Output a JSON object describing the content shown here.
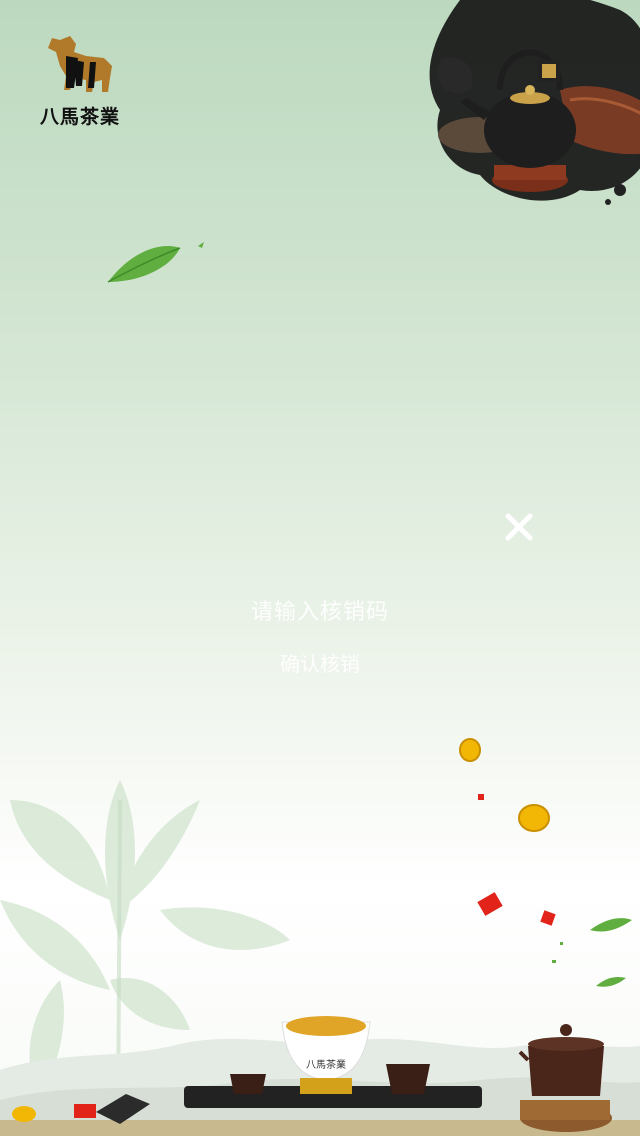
{
  "brand": {
    "name": "八馬茶業",
    "cup_label": "八馬茶業"
  },
  "modal": {
    "prompt": "请输入核销码",
    "confirm_label": "确认核销"
  },
  "icons": {
    "close": "close-icon",
    "logo": "horse-logo-icon"
  },
  "colors": {
    "background_top": "#bcd9bf",
    "background_bottom": "#ffffff",
    "leaf": "#5fae3f",
    "ink": "#1a1a1a",
    "coin": "#f2b705",
    "envelope": "#e2231a",
    "tea": "#e0a526"
  }
}
